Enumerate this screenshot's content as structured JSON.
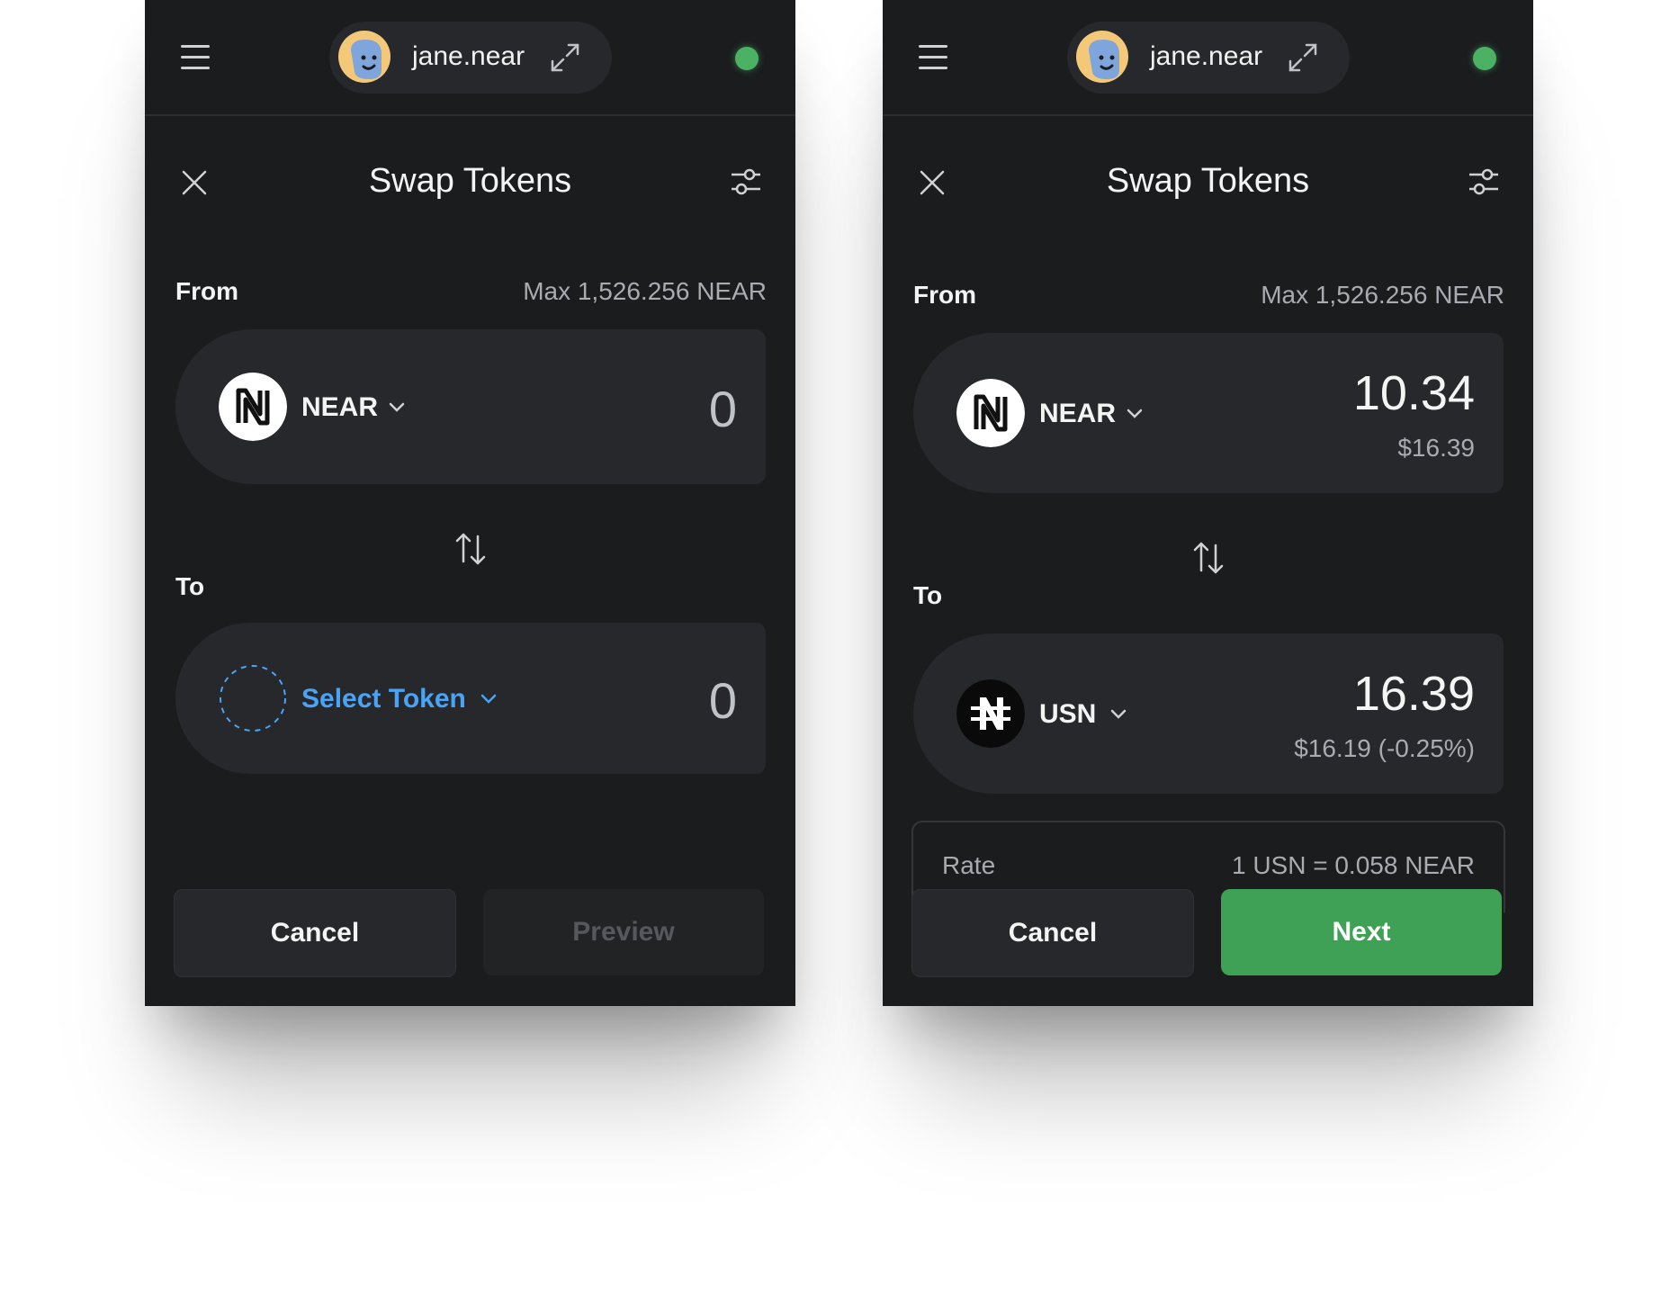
{
  "colors": {
    "background": "#1b1c1e",
    "surface": "#26282b",
    "accent_green": "#3ea156",
    "status_green": "#4bb264",
    "link_blue": "#4aa3f5"
  },
  "panels": [
    {
      "account": {
        "name": "jane.near"
      },
      "header": {
        "title": "Swap Tokens"
      },
      "from": {
        "label": "From",
        "max": "Max 1,526.256 NEAR",
        "token": "NEAR",
        "amount": "0"
      },
      "to": {
        "label": "To",
        "token": "Select Token",
        "amount": "0"
      },
      "buttons": {
        "cancel": "Cancel",
        "primary": "Preview"
      }
    },
    {
      "account": {
        "name": "jane.near"
      },
      "header": {
        "title": "Swap Tokens"
      },
      "from": {
        "label": "From",
        "max": "Max 1,526.256 NEAR",
        "token": "NEAR",
        "amount": "10.34",
        "fiat": "$16.39"
      },
      "to": {
        "label": "To",
        "token": "USN",
        "amount": "16.39",
        "fiat": "$16.19 (-0.25%)"
      },
      "rate": {
        "label": "Rate",
        "value": "1 USN = 0.058 NEAR"
      },
      "buttons": {
        "cancel": "Cancel",
        "primary": "Next"
      }
    }
  ]
}
